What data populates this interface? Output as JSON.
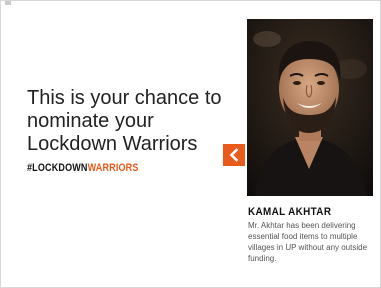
{
  "promo": {
    "headline": "This is your chance to nominate your Lockdown Warriors",
    "hashtag_part1": "#LOCKDOWN",
    "hashtag_part2": "WARRIORS"
  },
  "carousel": {
    "prev_icon": "chevron-left-icon"
  },
  "featured": {
    "name": "KAMAL AKHTAR",
    "description": "Mr. Akhtar has been delivering essential food items to multiple villages in UP without any outside funding."
  },
  "colors": {
    "accent": "#ea5a1a",
    "text": "#222222",
    "muted": "#555555"
  }
}
